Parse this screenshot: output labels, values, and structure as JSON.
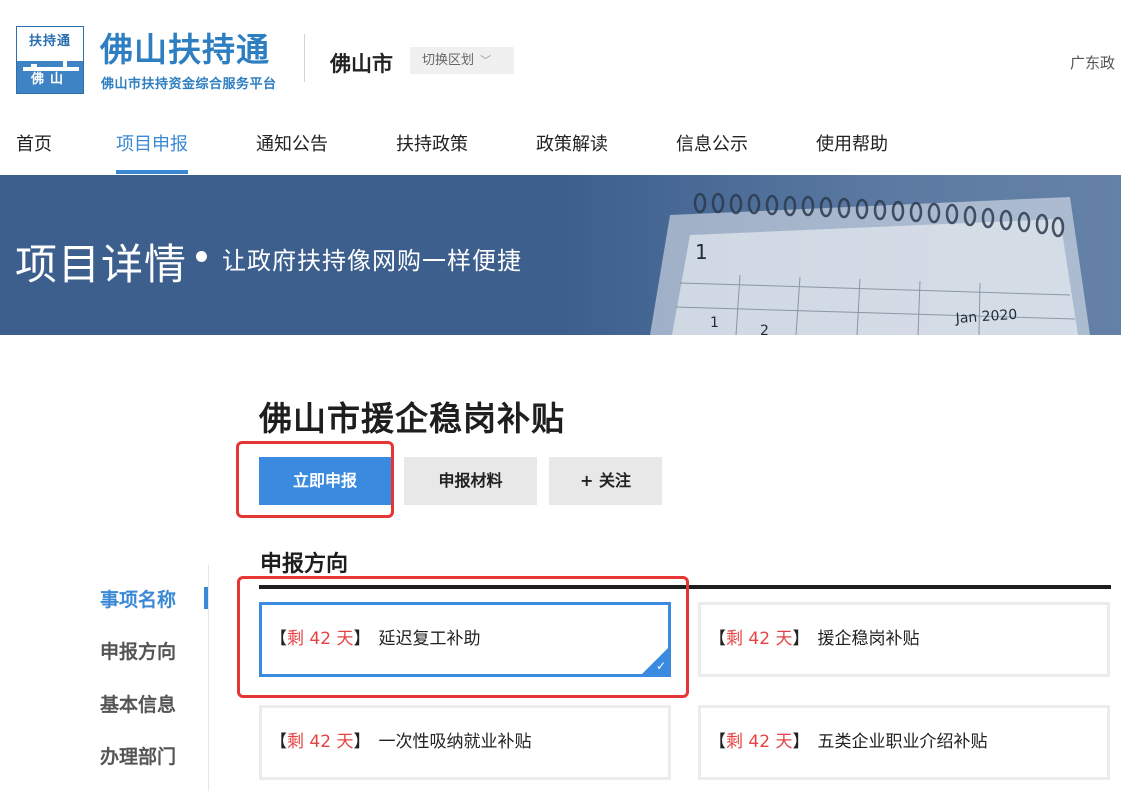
{
  "header": {
    "logo_badge_top": "扶持通",
    "logo_badge_bottom": "佛山",
    "logo_title": "佛山扶持通",
    "logo_subtitle": "佛山市扶持资金综合服务平台",
    "city": "佛山市",
    "switch_region_label": "切换区划",
    "top_right_text": "广东政"
  },
  "nav": {
    "items": [
      {
        "label": "首页"
      },
      {
        "label": "项目申报"
      },
      {
        "label": "通知公告"
      },
      {
        "label": "扶持政策"
      },
      {
        "label": "政策解读"
      },
      {
        "label": "信息公示"
      },
      {
        "label": "使用帮助"
      }
    ],
    "active": "项目申报"
  },
  "banner": {
    "title": "项目详情",
    "slogan": "让政府扶持像网购一样便捷",
    "calendar_month": "Jan 2020",
    "calendar_num_1": "1",
    "calendar_num_2": "1",
    "calendar_num_3": "2"
  },
  "project": {
    "title": "佛山市援企稳岗补贴",
    "apply_label": "立即申报",
    "materials_label": "申报材料",
    "follow_label": "+ 关注"
  },
  "section": {
    "title": "申报方向"
  },
  "sidebar": {
    "items": [
      {
        "label": "事项名称"
      },
      {
        "label": "申报方向"
      },
      {
        "label": "基本信息"
      },
      {
        "label": "办理部门"
      }
    ]
  },
  "directions": [
    {
      "open": "【",
      "days": "剩 42 天",
      "close": "】",
      "name": "延迟复工补助",
      "selected": true
    },
    {
      "open": "【",
      "days": "剩 42 天",
      "close": "】",
      "name": "援企稳岗补贴",
      "selected": false
    },
    {
      "open": "【",
      "days": "剩 42 天",
      "close": "】",
      "name": "一次性吸纳就业补贴",
      "selected": false
    },
    {
      "open": "【",
      "days": "剩 42 天",
      "close": "】",
      "name": "五类企业职业介绍补贴",
      "selected": false
    }
  ],
  "colors": {
    "brand_blue": "#3a88d6",
    "banner_bg": "#3c5f8e",
    "days_red": "#e54343",
    "annotation_red": "#e53535"
  }
}
